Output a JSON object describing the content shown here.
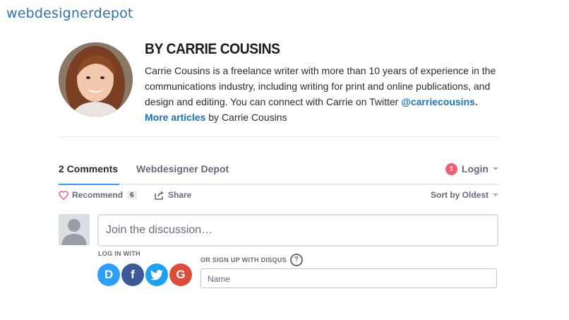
{
  "site": {
    "logo_text": "webdesignerdepot"
  },
  "author": {
    "heading": "BY CARRIE COUSINS",
    "bio_text": "Carrie Cousins is a freelance writer with more than 10 years of experience in the communications industry, including writing for print and online publications, and design and editing. You can connect with Carrie on Twitter ",
    "twitter_handle": "@carriecousins.",
    "more_articles": "More articles",
    "by_suffix": " by Carrie Cousins"
  },
  "comments": {
    "tab_active": "2 Comments",
    "tab_site": "Webdesigner Depot",
    "notification_count": "1",
    "login_label": "Login",
    "recommend_label": "Recommend",
    "recommend_count": "6",
    "share_label": "Share",
    "sort_label": "Sort by Oldest",
    "placeholder": "Join the discussion…",
    "login_with": "LOG IN WITH",
    "signup_with": "OR SIGN UP WITH DISQUS",
    "help_symbol": "?",
    "name_placeholder": "Name"
  },
  "social_logins": [
    {
      "icon": "disqus-icon",
      "glyph": "D",
      "color": "#2e9fff"
    },
    {
      "icon": "facebook-icon",
      "glyph": "f",
      "color": "#3b5998"
    },
    {
      "icon": "twitter-icon",
      "glyph": "t",
      "color": "#1da1f2"
    },
    {
      "icon": "google-icon",
      "glyph": "G",
      "color": "#dd4b39"
    }
  ],
  "colors": {
    "accent": "#2e9fff",
    "link": "#1f73b7",
    "badge": "#f05f70"
  }
}
